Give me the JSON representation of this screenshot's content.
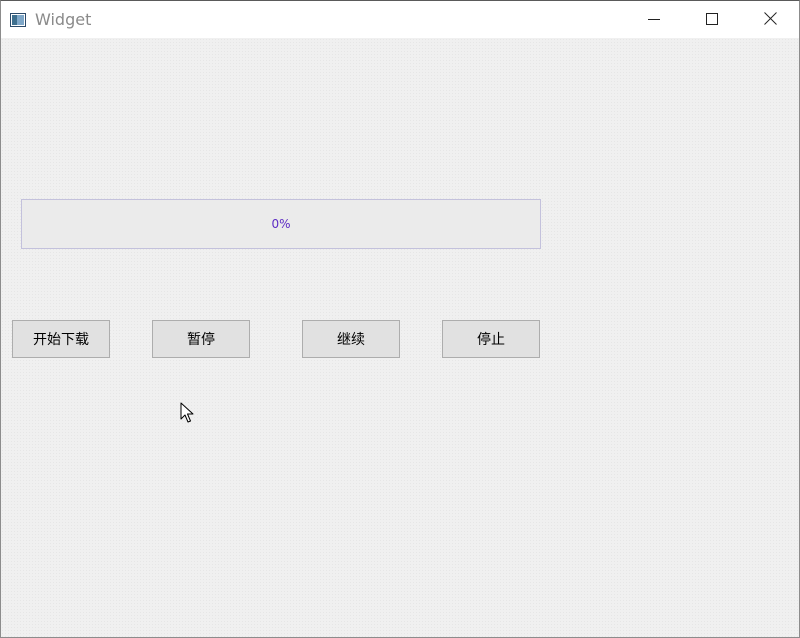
{
  "window": {
    "title": "Widget",
    "controls": [
      "minimize",
      "maximize",
      "close"
    ]
  },
  "progress": {
    "value": 0,
    "text": "0%",
    "text_color": "#5d2cc4"
  },
  "buttons": {
    "start_download": "开始下载",
    "pause": "暂停",
    "resume": "继续",
    "stop": "停止"
  },
  "icons": [
    "app-window-icon",
    "minimize-icon",
    "maximize-icon",
    "close-icon",
    "mouse-pointer-icon"
  ]
}
